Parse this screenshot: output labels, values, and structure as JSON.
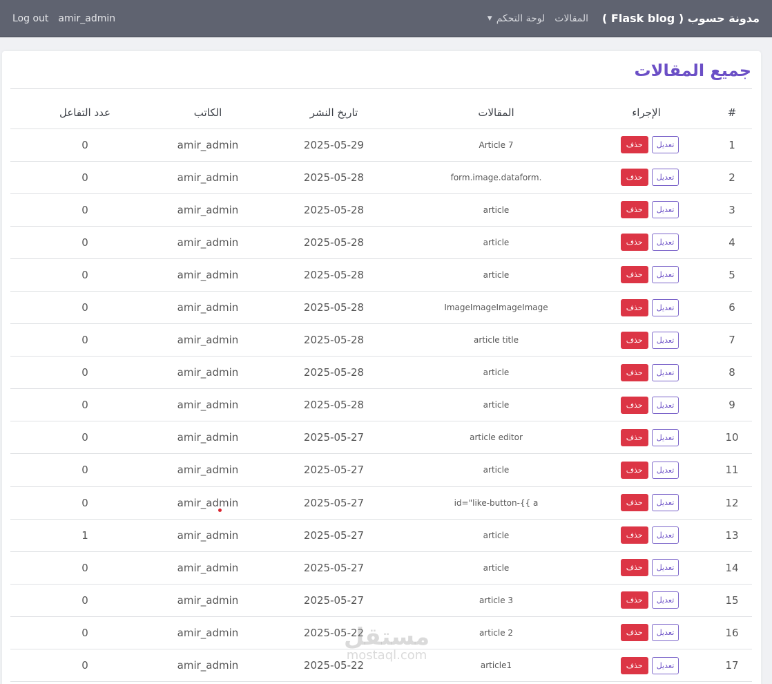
{
  "navbar": {
    "brand": "مدونة حسوب ( Flask blog )",
    "articles_link": "المقالات",
    "dashboard_link": "لوحة التحكم",
    "username": "amir_admin",
    "logout": "Log out"
  },
  "page": {
    "title": "جميع المقالات"
  },
  "table": {
    "headers": {
      "num": "#",
      "action": "الإجراء",
      "article": "المقالات",
      "date": "تاريخ النشر",
      "author": "الكاتب",
      "reactions": "عدد التفاعل"
    },
    "edit_label": "تعديل",
    "delete_label": "حذف",
    "rows": [
      {
        "num": "1",
        "article": "Article 7",
        "date": "2025-05-29",
        "author": "amir_admin",
        "reactions": "0"
      },
      {
        "num": "2",
        "article": "form.image.dataform.",
        "date": "2025-05-28",
        "author": "amir_admin",
        "reactions": "0"
      },
      {
        "num": "3",
        "article": "article",
        "date": "2025-05-28",
        "author": "amir_admin",
        "reactions": "0"
      },
      {
        "num": "4",
        "article": "article",
        "date": "2025-05-28",
        "author": "amir_admin",
        "reactions": "0"
      },
      {
        "num": "5",
        "article": "article",
        "date": "2025-05-28",
        "author": "amir_admin",
        "reactions": "0"
      },
      {
        "num": "6",
        "article": "ImageImageImageImage",
        "date": "2025-05-28",
        "author": "amir_admin",
        "reactions": "0"
      },
      {
        "num": "7",
        "article": "article title",
        "date": "2025-05-28",
        "author": "amir_admin",
        "reactions": "0"
      },
      {
        "num": "8",
        "article": "article",
        "date": "2025-05-28",
        "author": "amir_admin",
        "reactions": "0"
      },
      {
        "num": "9",
        "article": "article",
        "date": "2025-05-28",
        "author": "amir_admin",
        "reactions": "0"
      },
      {
        "num": "10",
        "article": "article editor",
        "date": "2025-05-27",
        "author": "amir_admin",
        "reactions": "0"
      },
      {
        "num": "11",
        "article": "article",
        "date": "2025-05-27",
        "author": "amir_admin",
        "reactions": "0"
      },
      {
        "num": "12",
        "article": "id=\"like-button-{{ a",
        "date": "2025-05-27",
        "author": "amir_admin",
        "reactions": "0"
      },
      {
        "num": "13",
        "article": "article",
        "date": "2025-05-27",
        "author": "amir_admin",
        "reactions": "1"
      },
      {
        "num": "14",
        "article": "article",
        "date": "2025-05-27",
        "author": "amir_admin",
        "reactions": "0"
      },
      {
        "num": "15",
        "article": "article 3",
        "date": "2025-05-27",
        "author": "amir_admin",
        "reactions": "0"
      },
      {
        "num": "16",
        "article": "article 2",
        "date": "2025-05-22",
        "author": "amir_admin",
        "reactions": "0"
      },
      {
        "num": "17",
        "article": "article1",
        "date": "2025-05-22",
        "author": "amir_admin",
        "reactions": "0"
      }
    ]
  },
  "watermark": {
    "arabic": "مستقل",
    "latin": "mostaql.com"
  },
  "colors": {
    "navbar": "#5f6370",
    "accent": "#6b4fc6",
    "danger": "#dc3545"
  }
}
